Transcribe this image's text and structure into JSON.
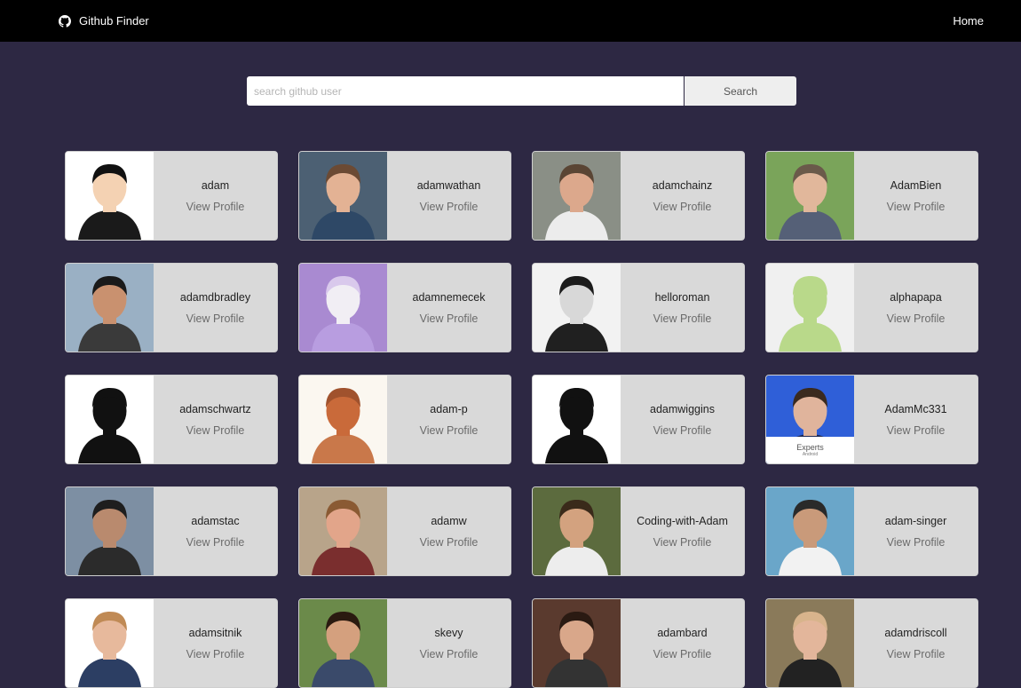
{
  "navbar": {
    "brand_label": "Github Finder",
    "home_label": "Home"
  },
  "search": {
    "placeholder": "search github user",
    "value": "",
    "button_label": "Search"
  },
  "users": [
    {
      "login": "adam",
      "link": "View Profile",
      "avatar": {
        "bg": "#ffffff",
        "skin": "#f4d2b3",
        "hair": "#111111",
        "shirt": "#1a1a1a"
      }
    },
    {
      "login": "adamwathan",
      "link": "View Profile",
      "avatar": {
        "bg": "#4c6073",
        "skin": "#e3b294",
        "hair": "#6b4a34",
        "shirt": "#2e4866"
      }
    },
    {
      "login": "adamchainz",
      "link": "View Profile",
      "avatar": {
        "bg": "#8a8f86",
        "skin": "#dca88c",
        "hair": "#5a4534",
        "shirt": "#ececec"
      }
    },
    {
      "login": "AdamBien",
      "link": "View Profile",
      "avatar": {
        "bg": "#7aa45a",
        "skin": "#e1b79b",
        "hair": "#6a5a4a",
        "shirt": "#556077"
      }
    },
    {
      "login": "adamdbradley",
      "link": "View Profile",
      "avatar": {
        "bg": "#9ab0c4",
        "skin": "#c9916f",
        "hair": "#1a1a1a",
        "shirt": "#3a3a3a"
      }
    },
    {
      "login": "adamnemecek",
      "link": "View Profile",
      "avatar": {
        "bg": "#a98ad1",
        "skin": "#f1eef4",
        "hair": "#d9c9ec",
        "shirt": "#b89de0"
      }
    },
    {
      "login": "helloroman",
      "link": "View Profile",
      "avatar": {
        "bg": "#f2f2f2",
        "skin": "#d8d8d8",
        "hair": "#1c1c1c",
        "shirt": "#202020"
      }
    },
    {
      "login": "alphapapa",
      "link": "View Profile",
      "avatar": {
        "bg": "#f0f0f0",
        "skin": "#b9d98a",
        "hair": "#b9d98a",
        "shirt": "#b9d98a"
      }
    },
    {
      "login": "adamschwartz",
      "link": "View Profile",
      "avatar": {
        "bg": "#ffffff",
        "skin": "#111111",
        "hair": "#111111",
        "shirt": "#111111"
      }
    },
    {
      "login": "adam-p",
      "link": "View Profile",
      "avatar": {
        "bg": "#fbf7f0",
        "skin": "#c96a3a",
        "hair": "#a0522d",
        "shirt": "#c9784a"
      }
    },
    {
      "login": "adamwiggins",
      "link": "View Profile",
      "avatar": {
        "bg": "#ffffff",
        "skin": "#111111",
        "hair": "#111111",
        "shirt": "#111111"
      }
    },
    {
      "login": "AdamMc331",
      "link": "View Profile",
      "avatar": {
        "bg": "#2f5fd8",
        "skin": "#e0b49c",
        "hair": "#3a2a1f",
        "shirt": "#1f2a55",
        "caption": "Experts",
        "subcaption": "Android"
      }
    },
    {
      "login": "adamstac",
      "link": "View Profile",
      "avatar": {
        "bg": "#7d8fa3",
        "skin": "#b98a6e",
        "hair": "#1e1e1e",
        "shirt": "#2b2b2b"
      }
    },
    {
      "login": "adamw",
      "link": "View Profile",
      "avatar": {
        "bg": "#b8a48a",
        "skin": "#e2a58a",
        "hair": "#8a5a33",
        "shirt": "#7a2e2e"
      }
    },
    {
      "login": "Coding-with-Adam",
      "link": "View Profile",
      "avatar": {
        "bg": "#5c6b3e",
        "skin": "#d3a27f",
        "hair": "#3a2a1a",
        "shirt": "#ededed"
      }
    },
    {
      "login": "adam-singer",
      "link": "View Profile",
      "avatar": {
        "bg": "#6aa6c9",
        "skin": "#c99a7a",
        "hair": "#2a2a2a",
        "shirt": "#f2f2f2"
      }
    },
    {
      "login": "adamsitnik",
      "link": "View Profile",
      "avatar": {
        "bg": "#ffffff",
        "skin": "#e7b99c",
        "hair": "#c08a55",
        "shirt": "#2c3e63"
      }
    },
    {
      "login": "skevy",
      "link": "View Profile",
      "avatar": {
        "bg": "#6b8a4a",
        "skin": "#d4a07e",
        "hair": "#2a1a10",
        "shirt": "#3a4a6a"
      }
    },
    {
      "login": "adambard",
      "link": "View Profile",
      "avatar": {
        "bg": "#5a3a2e",
        "skin": "#d9a78a",
        "hair": "#2a1a12",
        "shirt": "#333333"
      }
    },
    {
      "login": "adamdriscoll",
      "link": "View Profile",
      "avatar": {
        "bg": "#8a7a5a",
        "skin": "#e3b69b",
        "hair": "#d8b48c",
        "shirt": "#222222"
      }
    }
  ]
}
